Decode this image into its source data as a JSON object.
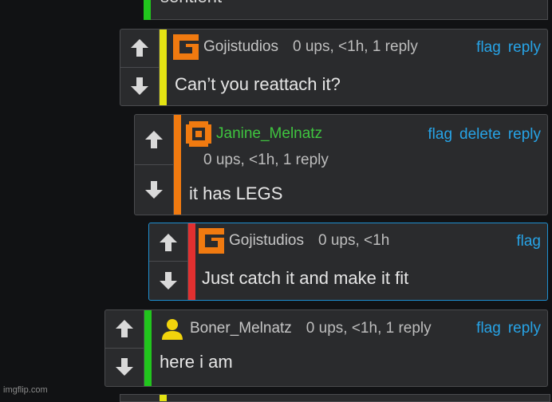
{
  "top_partial": {
    "text": "sentient",
    "bar_color": "#21c61d"
  },
  "comments": [
    {
      "username": "Gojistudios",
      "meta": "0 ups, <1h, 1 reply",
      "actions": [
        "flag",
        "reply"
      ],
      "body": "Can’t you reattach it?",
      "bar_color": "#e3e313",
      "avatar": "orange-g-avatar"
    },
    {
      "username": "Janine_Melnatz",
      "meta": "0 ups, <1h, 1 reply",
      "actions": [
        "flag",
        "delete",
        "reply"
      ],
      "body": "it has LEGS",
      "bar_color": "#f07a10",
      "avatar": "orange-square-avatar"
    },
    {
      "username": "Gojistudios",
      "meta": "0 ups, <1h",
      "actions": [
        "flag"
      ],
      "body": "Just catch it and make it fit",
      "bar_color": "#e23030",
      "avatar": "orange-g-avatar"
    },
    {
      "username": "Boner_Melnatz",
      "meta": "0 ups, <1h, 1 reply",
      "actions": [
        "flag",
        "reply"
      ],
      "body": "here i am",
      "bar_color": "#21c61d",
      "avatar": "yellow-user-avatar"
    }
  ],
  "colors": {
    "link": "#27a3e6",
    "username_green": "#3fc43f",
    "highlight_border": "#1f8fd0",
    "avatar_orange": "#f07a10",
    "avatar_yellow": "#f2d40c"
  },
  "watermark": "imgflip.com"
}
